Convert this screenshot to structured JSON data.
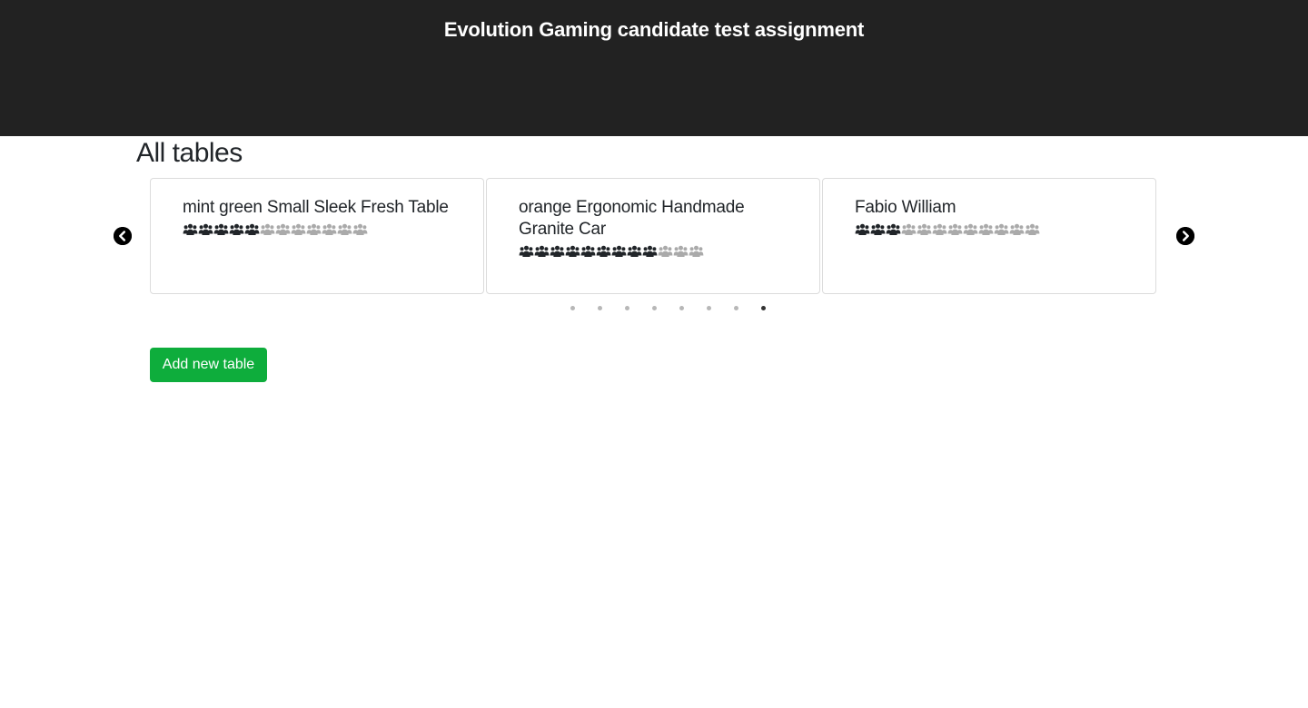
{
  "header": {
    "title": "Evolution Gaming candidate test assignment"
  },
  "main": {
    "heading": "All tables",
    "add_button_label": "Add new table"
  },
  "carousel": {
    "prev_icon": "chevron-left-circle-icon",
    "next_icon": "chevron-right-circle-icon",
    "seat_icon": "users-icon",
    "occupied_color": "#212529",
    "free_color": "#aaaaaa",
    "cards": [
      {
        "name": "mint green Small Sleek Fresh Table",
        "seats_total": 12,
        "seats_occupied": 5
      },
      {
        "name": "orange Ergonomic Handmade Granite Car",
        "seats_total": 12,
        "seats_occupied": 9
      },
      {
        "name": "Fabio William",
        "seats_total": 12,
        "seats_occupied": 3
      }
    ],
    "page_count": 8,
    "active_page": 8
  },
  "colors": {
    "header_bg": "#222222",
    "accent_green": "#0ead3c"
  }
}
